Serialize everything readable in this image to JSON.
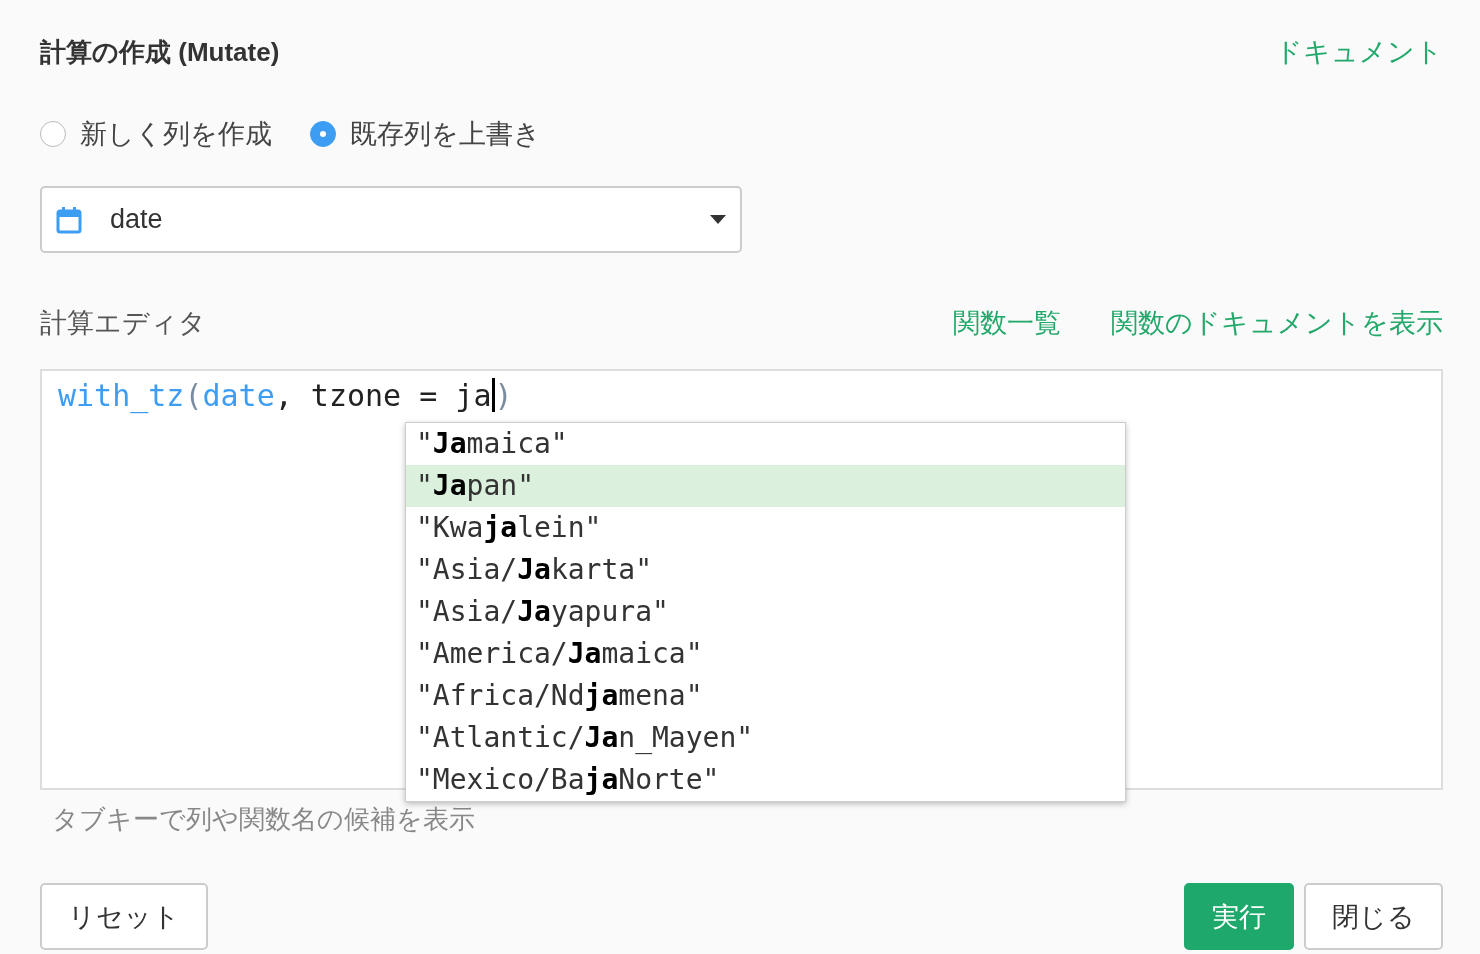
{
  "header": {
    "title": "計算の作成 (Mutate)",
    "doc_link": "ドキュメント"
  },
  "mode_options": [
    {
      "label": "新しく列を作成",
      "selected": false
    },
    {
      "label": "既存列を上書き",
      "selected": true
    }
  ],
  "column_select": {
    "value": "date"
  },
  "editor": {
    "label": "計算エディタ",
    "links": [
      "関数一覧",
      "関数のドキュメントを表示"
    ],
    "code_tokens": [
      {
        "kind": "function",
        "text": "with_tz"
      },
      {
        "kind": "paren",
        "text": "("
      },
      {
        "kind": "identifier",
        "text": "date"
      },
      {
        "kind": "plain",
        "text": ", tzone = ja"
      },
      {
        "kind": "cursor"
      },
      {
        "kind": "paren",
        "text": ")"
      }
    ],
    "suggestions": [
      {
        "text": "\"**Ja**maica\"",
        "selected": false
      },
      {
        "text": "\"**Ja**pan\"",
        "selected": true
      },
      {
        "text": "\"Kwa**ja**lein\"",
        "selected": false
      },
      {
        "text": "\"Asia/**Ja**karta\"",
        "selected": false
      },
      {
        "text": "\"Asia/**Ja**yapura\"",
        "selected": false
      },
      {
        "text": "\"America/**Ja**maica\"",
        "selected": false
      },
      {
        "text": "\"Africa/Nd**ja**mena\"",
        "selected": false
      },
      {
        "text": "\"Atlantic/**Ja**n_Mayen\"",
        "selected": false
      },
      {
        "text": "\"Mexico/Ba**ja**Norte\"",
        "selected": false
      }
    ],
    "hint": "タブキーで列や関数名の候補を表示"
  },
  "buttons": [
    {
      "kind": "secondary",
      "label": "リセット"
    },
    {
      "kind": "primary",
      "label": "実行"
    },
    {
      "kind": "secondary",
      "label": "閉じる"
    }
  ]
}
